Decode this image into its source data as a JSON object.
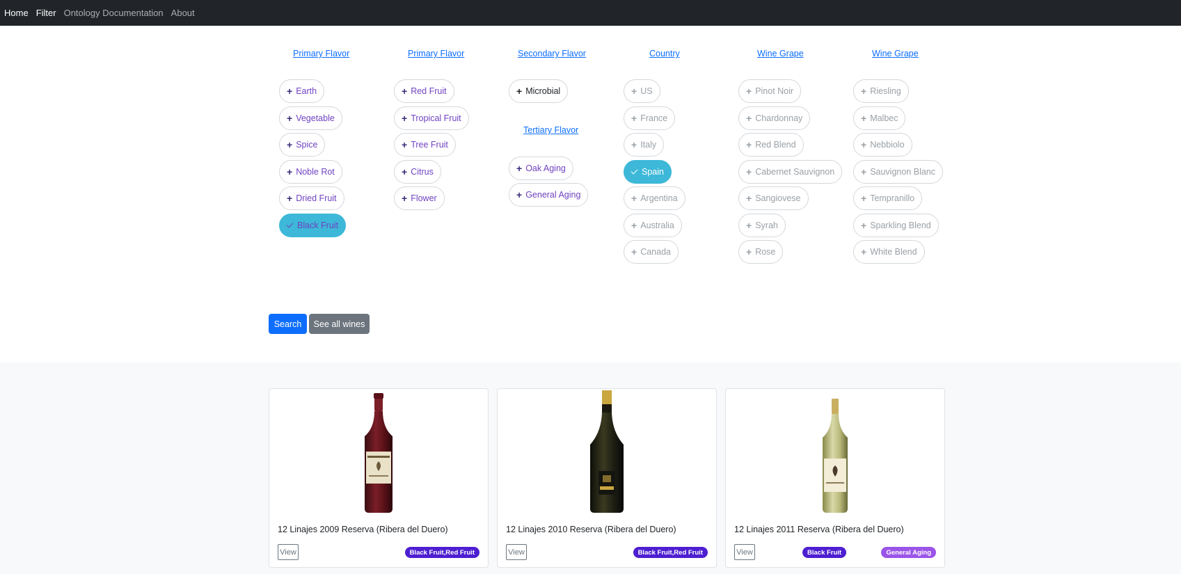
{
  "nav": {
    "items": [
      {
        "label": "Home"
      },
      {
        "label": "Filter"
      },
      {
        "label": "Ontology Documentation"
      },
      {
        "label": "About"
      }
    ]
  },
  "filters": {
    "primary1": {
      "title": "Primary Flavor",
      "items": [
        "Earth",
        "Vegetable",
        "Spice",
        "Noble Rot",
        "Dried Fruit",
        "Black Fruit"
      ]
    },
    "primary2": {
      "title": "Primary Flavor",
      "items": [
        "Red Fruit",
        "Tropical Fruit",
        "Tree Fruit",
        "Citrus",
        "Flower"
      ]
    },
    "secondary": {
      "title": "Secondary Flavor",
      "items": [
        "Microbial"
      ]
    },
    "tertiary": {
      "title": "Tertiary Flavor",
      "items": [
        "Oak Aging",
        "General Aging"
      ]
    },
    "country": {
      "title": "Country",
      "items": [
        "US",
        "France",
        "Italy",
        "Spain",
        "Argentina",
        "Australia",
        "Canada"
      ]
    },
    "grape1": {
      "title": "Wine Grape",
      "items": [
        "Pinot Noir",
        "Chardonnay",
        "Red Blend",
        "Cabernet Sauvignon",
        "Sangiovese",
        "Syrah",
        "Rose"
      ]
    },
    "grape2": {
      "title": "Wine Grape",
      "items": [
        "Riesling",
        "Malbec",
        "Nebbiolo",
        "Sauvignon Blanc",
        "Tempranillo",
        "Sparkling Blend",
        "White Blend"
      ]
    },
    "selected": [
      "Black Fruit",
      "Spain"
    ]
  },
  "actions": {
    "search_label": "Search",
    "see_all_label": "See all wines"
  },
  "wines": [
    {
      "title": "12 Linajes 2009 Reserva (Ribera del Duero)",
      "view_label": "View",
      "badges": [
        "Black Fruit,Red Fruit"
      ]
    },
    {
      "title": "12 Linajes 2010 Reserva (Ribera del Duero)",
      "view_label": "View",
      "badges": [
        "Black Fruit,Red Fruit"
      ]
    },
    {
      "title": "12 Linajes 2011 Reserva (Ribera del Duero)",
      "view_label": "View",
      "badges": [
        "Black Fruit",
        "General Aging"
      ]
    }
  ],
  "colors": {
    "primary": "#0d6efd",
    "selected_pill": "#3db8d8",
    "badge_indigo": "#4d1fd1",
    "badge_violet": "#9b54e8"
  }
}
